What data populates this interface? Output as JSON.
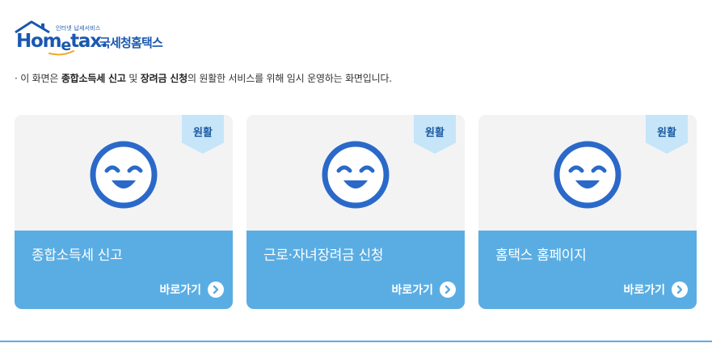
{
  "header": {
    "logo_tagline": "인터넷 납세서비스",
    "logo_text_home": "Hom",
    "logo_text_e": "e",
    "logo_text_tax": "tax.",
    "logo_subtitle": "국세청홈택스"
  },
  "notice": {
    "prefix": "· 이 화면은 ",
    "bold1": "종합소득세 신고",
    "conj": " 및 ",
    "bold2": "장려금 신청",
    "suffix": "의 원활한 서비스를 위해 임시 운영하는 화면입니다."
  },
  "cards": [
    {
      "status": "원활",
      "title": "종합소득세 신고",
      "link": "바로가기"
    },
    {
      "status": "원활",
      "title": "근로·자녀장려금 신청",
      "link": "바로가기"
    },
    {
      "status": "원활",
      "title": "홈택스 홈페이지",
      "link": "바로가기"
    }
  ],
  "icons": {
    "face": "smiley-face-icon",
    "arrow": "chevron-right-circle-icon",
    "logo": "house-roof-icon"
  },
  "colors": {
    "brand_blue": "#1a58b0",
    "card_blue": "#5aade3",
    "ribbon": "#c6e5f9",
    "face_blue": "#2a69c9",
    "card_bg": "#f3f3f3"
  }
}
